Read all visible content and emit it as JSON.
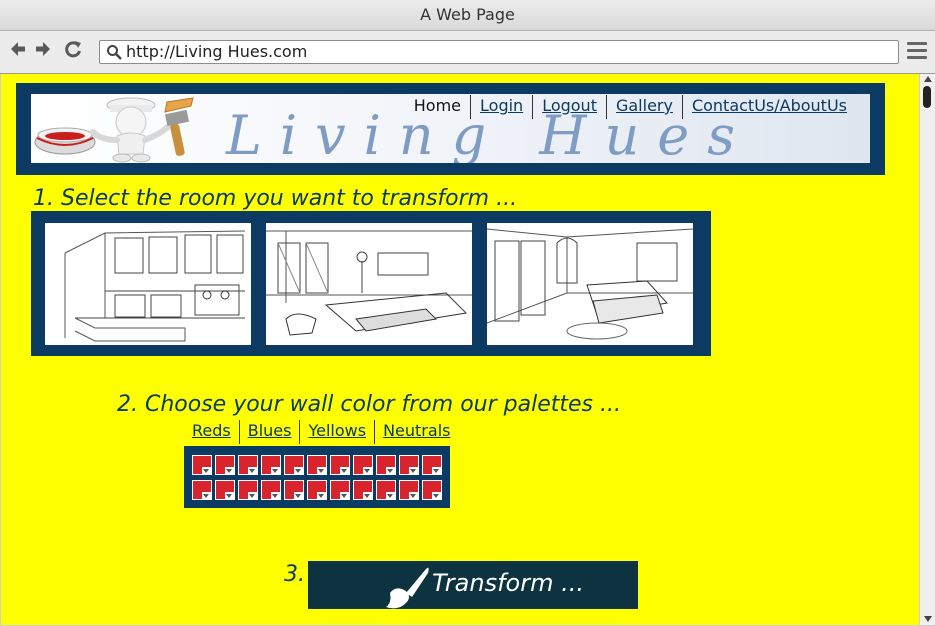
{
  "browser": {
    "window_title": "A Web Page",
    "url": "http://Living Hues.com"
  },
  "header": {
    "logo_text": "Living Hues",
    "nav": [
      {
        "label": "Home",
        "active": true
      },
      {
        "label": "Login"
      },
      {
        "label": "Logout"
      },
      {
        "label": "Gallery"
      },
      {
        "label": "ContactUs/AboutUs"
      }
    ]
  },
  "steps": {
    "step1": "1. Select the room you want to transform ...",
    "rooms": [
      "kitchen",
      "living-room",
      "bedroom"
    ],
    "step2": "2. Choose  your wall color from our palettes ...",
    "palettes": [
      "Reds",
      "Blues",
      "Yellows",
      "Neutrals"
    ],
    "swatch_rows": 2,
    "swatches_per_row": 11,
    "swatch_color": "#d8242c",
    "step3": "3.",
    "transform_label": "Transform ..."
  },
  "colors": {
    "page_bg": "#ffff00",
    "navy": "#0b3a63",
    "button_bg": "#0d3340"
  }
}
